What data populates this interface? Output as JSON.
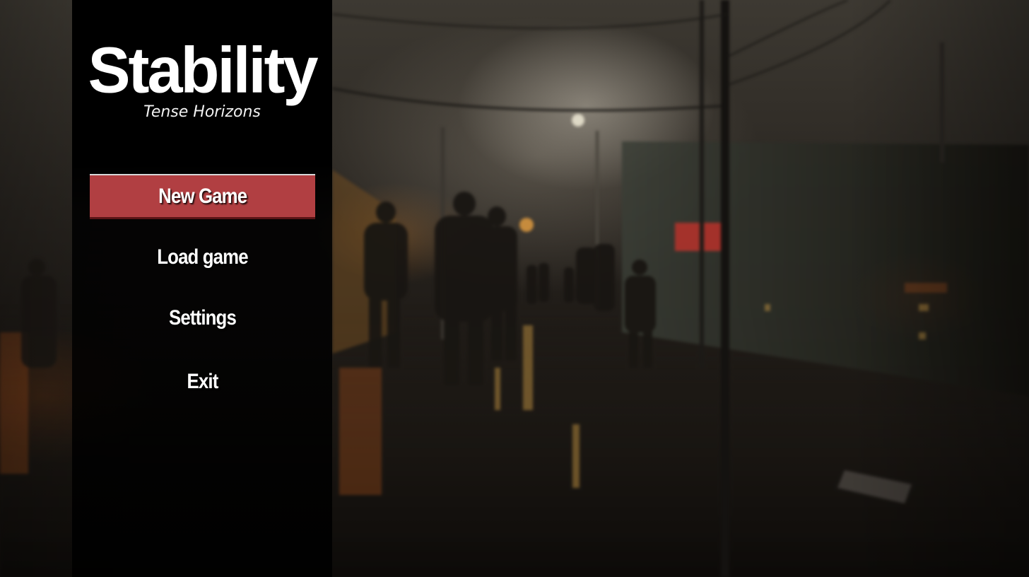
{
  "game": {
    "title": "Stability",
    "subtitle": "Tense Horizons"
  },
  "menu": {
    "selected_index": 0,
    "items": [
      {
        "label": "New Game"
      },
      {
        "label": "Load game"
      },
      {
        "label": "Settings"
      },
      {
        "label": "Exit"
      }
    ]
  },
  "colors": {
    "selected_button": "#b13f42",
    "panel": "#000000",
    "text": "#ffffff"
  },
  "background": {
    "scene": "rainy-street-soldiers-artwork"
  }
}
